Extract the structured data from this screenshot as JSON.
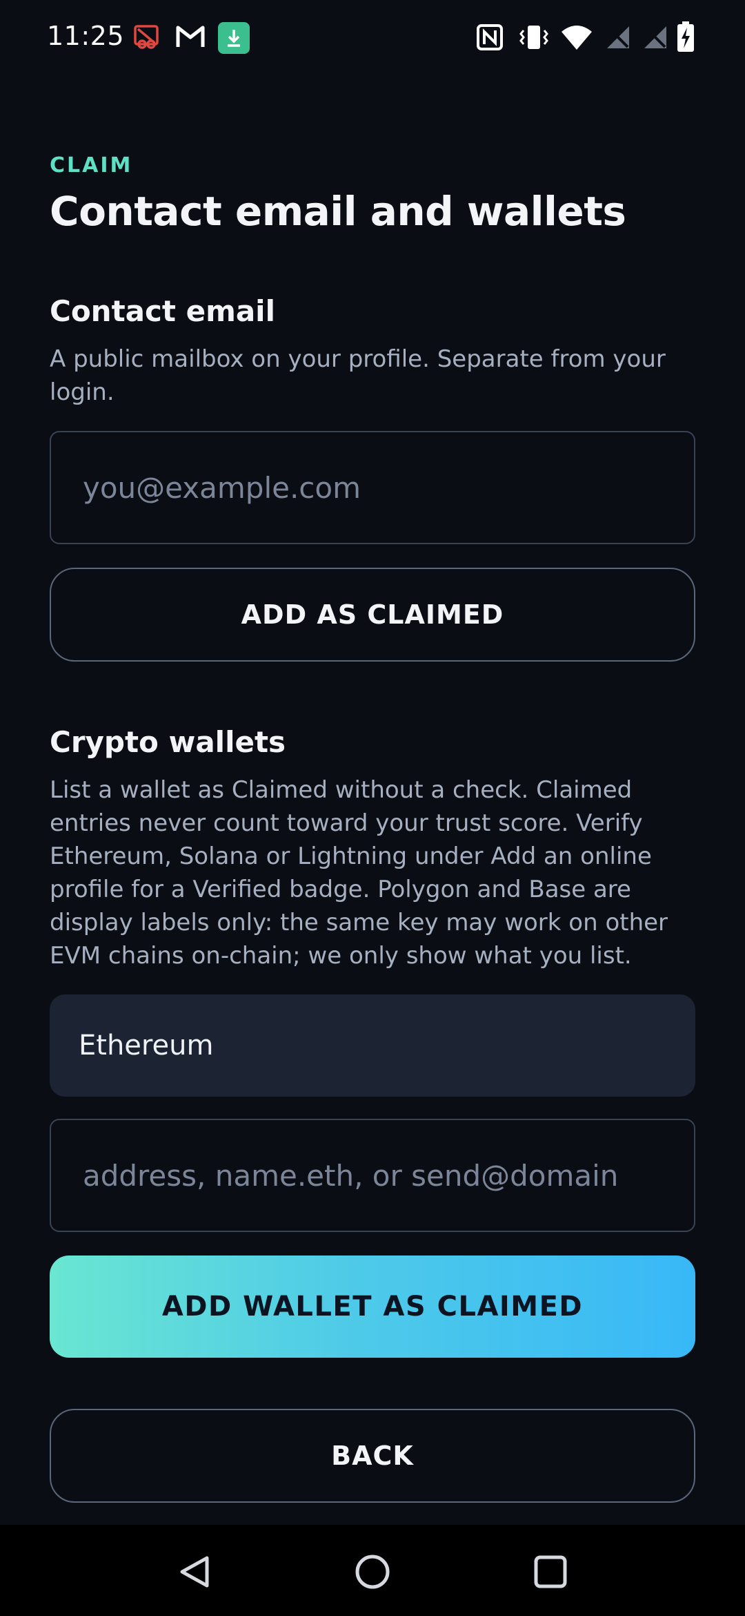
{
  "status_bar": {
    "time": "11:25",
    "left_icons": [
      "sync-off-icon",
      "gmail-icon",
      "download-icon"
    ],
    "right_icons": [
      "nfc-icon",
      "vibrate-icon",
      "wifi-icon",
      "no-signal-icon",
      "no-signal-icon",
      "battery-charging-icon"
    ],
    "download_badge_color": "#3cbf8f",
    "sync_off_color": "#e0473f"
  },
  "header": {
    "eyebrow": "CLAIM",
    "title": "Contact email and wallets"
  },
  "contact_email": {
    "title": "Contact email",
    "description": "A public mailbox on your profile. Separate from your login.",
    "input_placeholder": "you@example.com",
    "add_button": "ADD AS CLAIMED"
  },
  "crypto_wallets": {
    "title": "Crypto wallets",
    "description": "List a wallet as Claimed without a check. Claimed entries never count toward your trust score. Verify Ethereum, Solana or Lightning under Add an online profile for a Verified badge. Polygon and Base are display labels only: the same key may work on other EVM chains on-chain; we only show what you list.",
    "chain_selected": "Ethereum",
    "address_placeholder": "address, name.eth, or send@domain",
    "add_button": "ADD WALLET AS CLAIMED"
  },
  "back_button": "BACK",
  "nav_bar": {
    "icons": [
      "back-triangle-icon",
      "home-circle-icon",
      "recents-square-icon"
    ]
  },
  "colors": {
    "background": "#0a0e14",
    "accent": "#5fe0c4",
    "gradient_start": "#6ae6d2",
    "gradient_end": "#38b8f7"
  }
}
